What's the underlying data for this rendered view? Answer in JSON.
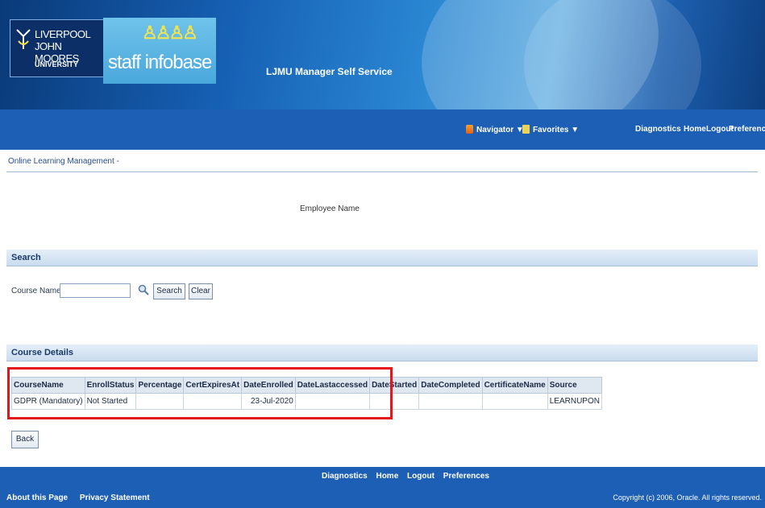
{
  "header": {
    "logo_line1": "LIVERPOOL",
    "logo_line2": "JOHN MOORES",
    "logo_line3": "UNIVERSITY",
    "infobase": "staff infobase",
    "app_title": "LJMU Manager Self Service"
  },
  "nav": {
    "navigator": "Navigator ▼",
    "favorites": "Favorites ▼",
    "links": [
      "Diagnostics",
      "Home",
      "Logout",
      "Preferences"
    ]
  },
  "breadcrumb": "Online Learning Management -",
  "employee_name_label": "Employee Name",
  "search_section": {
    "title": "Search",
    "course_name_label": "Course Name",
    "course_name_value": "",
    "search_button": "Search",
    "clear_button": "Clear"
  },
  "course_details": {
    "title": "Course Details",
    "columns": [
      "CourseName",
      "EnrollStatus",
      "Percentage",
      "CertExpiresAt",
      "DateEnrolled",
      "DateLastaccessed",
      "DateStarted",
      "DateCompleted",
      "CertificateName",
      "Source"
    ],
    "rows": [
      [
        "GDPR (Mandatory)",
        "Not Started",
        "",
        "",
        "23-Jul-2020",
        "",
        "",
        "",
        "",
        "LEARNUPON"
      ]
    ]
  },
  "back_button": "Back",
  "footer": {
    "links": [
      "Diagnostics",
      "Home",
      "Logout",
      "Preferences"
    ],
    "about": "About this Page",
    "privacy": "Privacy Statement",
    "copyright": "Copyright (c) 2006, Oracle. All rights reserved."
  },
  "colors": {
    "nav_blue": "#1c5fb4",
    "highlight_red": "#e4161b",
    "section_header": "#c9dcef"
  }
}
